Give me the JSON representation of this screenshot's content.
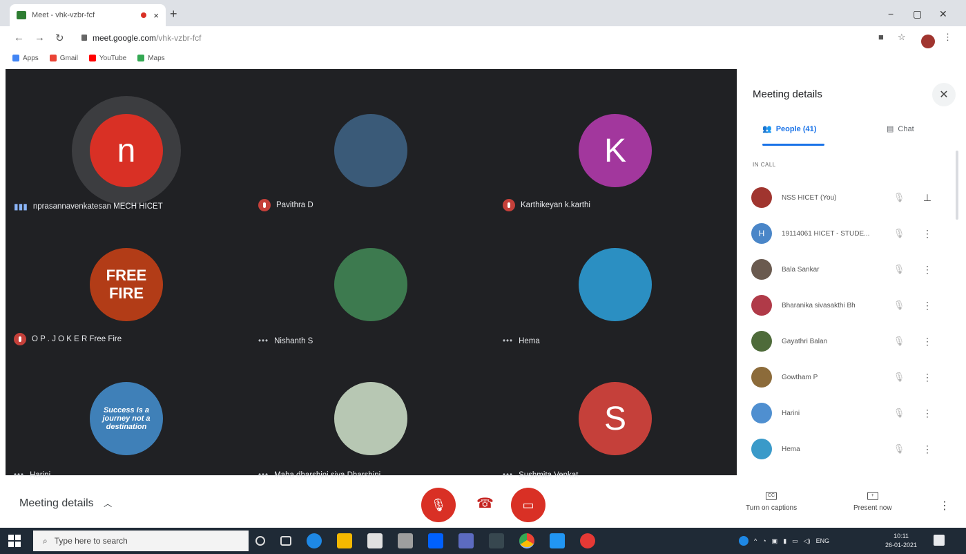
{
  "browser": {
    "tab_title": "Meet - vhk-vzbr-fcf",
    "tab_close": "×",
    "new_tab": "+",
    "url_host": "meet.google.com",
    "url_path": "/vhk-vzbr-fcf",
    "bookmarks": [
      {
        "label": "Apps",
        "color": "#4285f4"
      },
      {
        "label": "Gmail",
        "color": "#ea4335"
      },
      {
        "label": "YouTube",
        "color": "#ff0000"
      },
      {
        "label": "Maps",
        "color": "#34a853"
      }
    ]
  },
  "tiles": [
    {
      "name": "nprasannavenkatesan MECH HICET",
      "initial": "n",
      "color": "#d93025",
      "status": "speaking"
    },
    {
      "name": "Pavithra D",
      "initial": "",
      "color": "#3a5a78",
      "status": "muted"
    },
    {
      "name": "Karthikeyan k.karthi",
      "initial": "K",
      "color": "#a2379d",
      "status": "muted"
    },
    {
      "name": "O P . J O K E R Free Fire",
      "initial": "FREE FIRE",
      "color": "#b23c17",
      "status": "muted"
    },
    {
      "name": "Nishanth S",
      "initial": "",
      "color": "#3d7a4f",
      "status": "dots"
    },
    {
      "name": "Hema",
      "initial": "",
      "color": "#2b8fc2",
      "status": "dots"
    },
    {
      "name": "Harini",
      "initial": "Success is a journey not a destination",
      "color": "#3f80b8",
      "status": "dots"
    },
    {
      "name": "Maha dharshini siva Dharshini",
      "initial": "",
      "color": "#b7c7b3",
      "status": "dots"
    },
    {
      "name": "Sushmita Venkat",
      "initial": "S",
      "color": "#c5403a",
      "status": "dots"
    }
  ],
  "panel": {
    "title": "Meeting details",
    "close": "✕",
    "tab_people": "People (41)",
    "tab_chat": "Chat",
    "section": "IN CALL",
    "people": [
      {
        "name": "NSS HICET (You)",
        "avatar": "",
        "color": "#a0352f",
        "action": "pin"
      },
      {
        "name": "19114061 HICET - STUDE...",
        "avatar": "H",
        "color": "#4a86c8",
        "action": "more"
      },
      {
        "name": "Bala Sankar",
        "avatar": "",
        "color": "#6a5a4f",
        "action": "more"
      },
      {
        "name": "Bharanika sivasakthi Bh",
        "avatar": "",
        "color": "#b03a48",
        "action": "more"
      },
      {
        "name": "Gayathri Balan",
        "avatar": "",
        "color": "#4e6b3a",
        "action": "more"
      },
      {
        "name": "Gowtham P",
        "avatar": "",
        "color": "#8c6b3a",
        "action": "more"
      },
      {
        "name": "Harini",
        "avatar": "",
        "color": "#4f8fd0",
        "action": "more"
      },
      {
        "name": "Hema",
        "avatar": "",
        "color": "#3a9ac9",
        "action": "more"
      }
    ]
  },
  "bottombar": {
    "meeting_details": "Meeting details",
    "captions": "Turn on captions",
    "present": "Present now"
  },
  "taskbar": {
    "search_placeholder": "Type here to search",
    "lang": "ENG",
    "time": "10:11",
    "date": "26-01-2021"
  }
}
